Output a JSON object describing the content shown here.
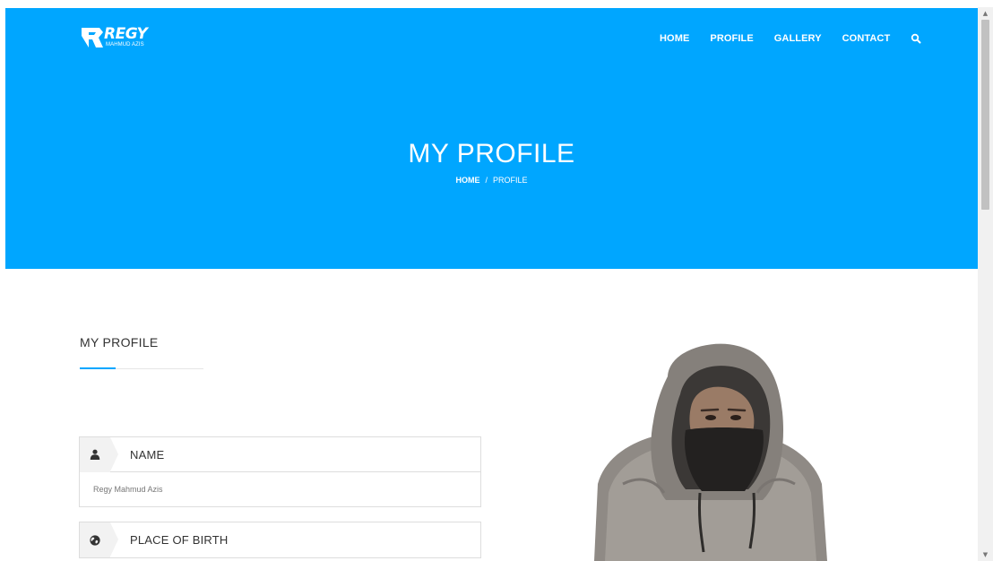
{
  "header": {
    "logo": {
      "name": "REGY",
      "subtitle": "MAHMUD AZIS"
    },
    "nav": {
      "items": [
        {
          "label": "HOME"
        },
        {
          "label": "PROFILE"
        },
        {
          "label": "GALLERY"
        },
        {
          "label": "CONTACT"
        }
      ],
      "search_icon": "search-icon"
    }
  },
  "hero": {
    "title": "MY PROFILE",
    "breadcrumb": {
      "home": "HOME",
      "separator": "/",
      "current": "PROFILE"
    },
    "background_color": "#00a6ff"
  },
  "main": {
    "section_title": "MY PROFILE",
    "accent_color": "#00a6ff",
    "fields": [
      {
        "icon": "user-icon",
        "label": "NAME",
        "value": "Regy Mahmud Azis"
      },
      {
        "icon": "globe-icon",
        "label": "PLACE OF BIRTH",
        "value": ""
      }
    ],
    "photo": {
      "subject": "person-in-hoodie-with-mask"
    }
  }
}
